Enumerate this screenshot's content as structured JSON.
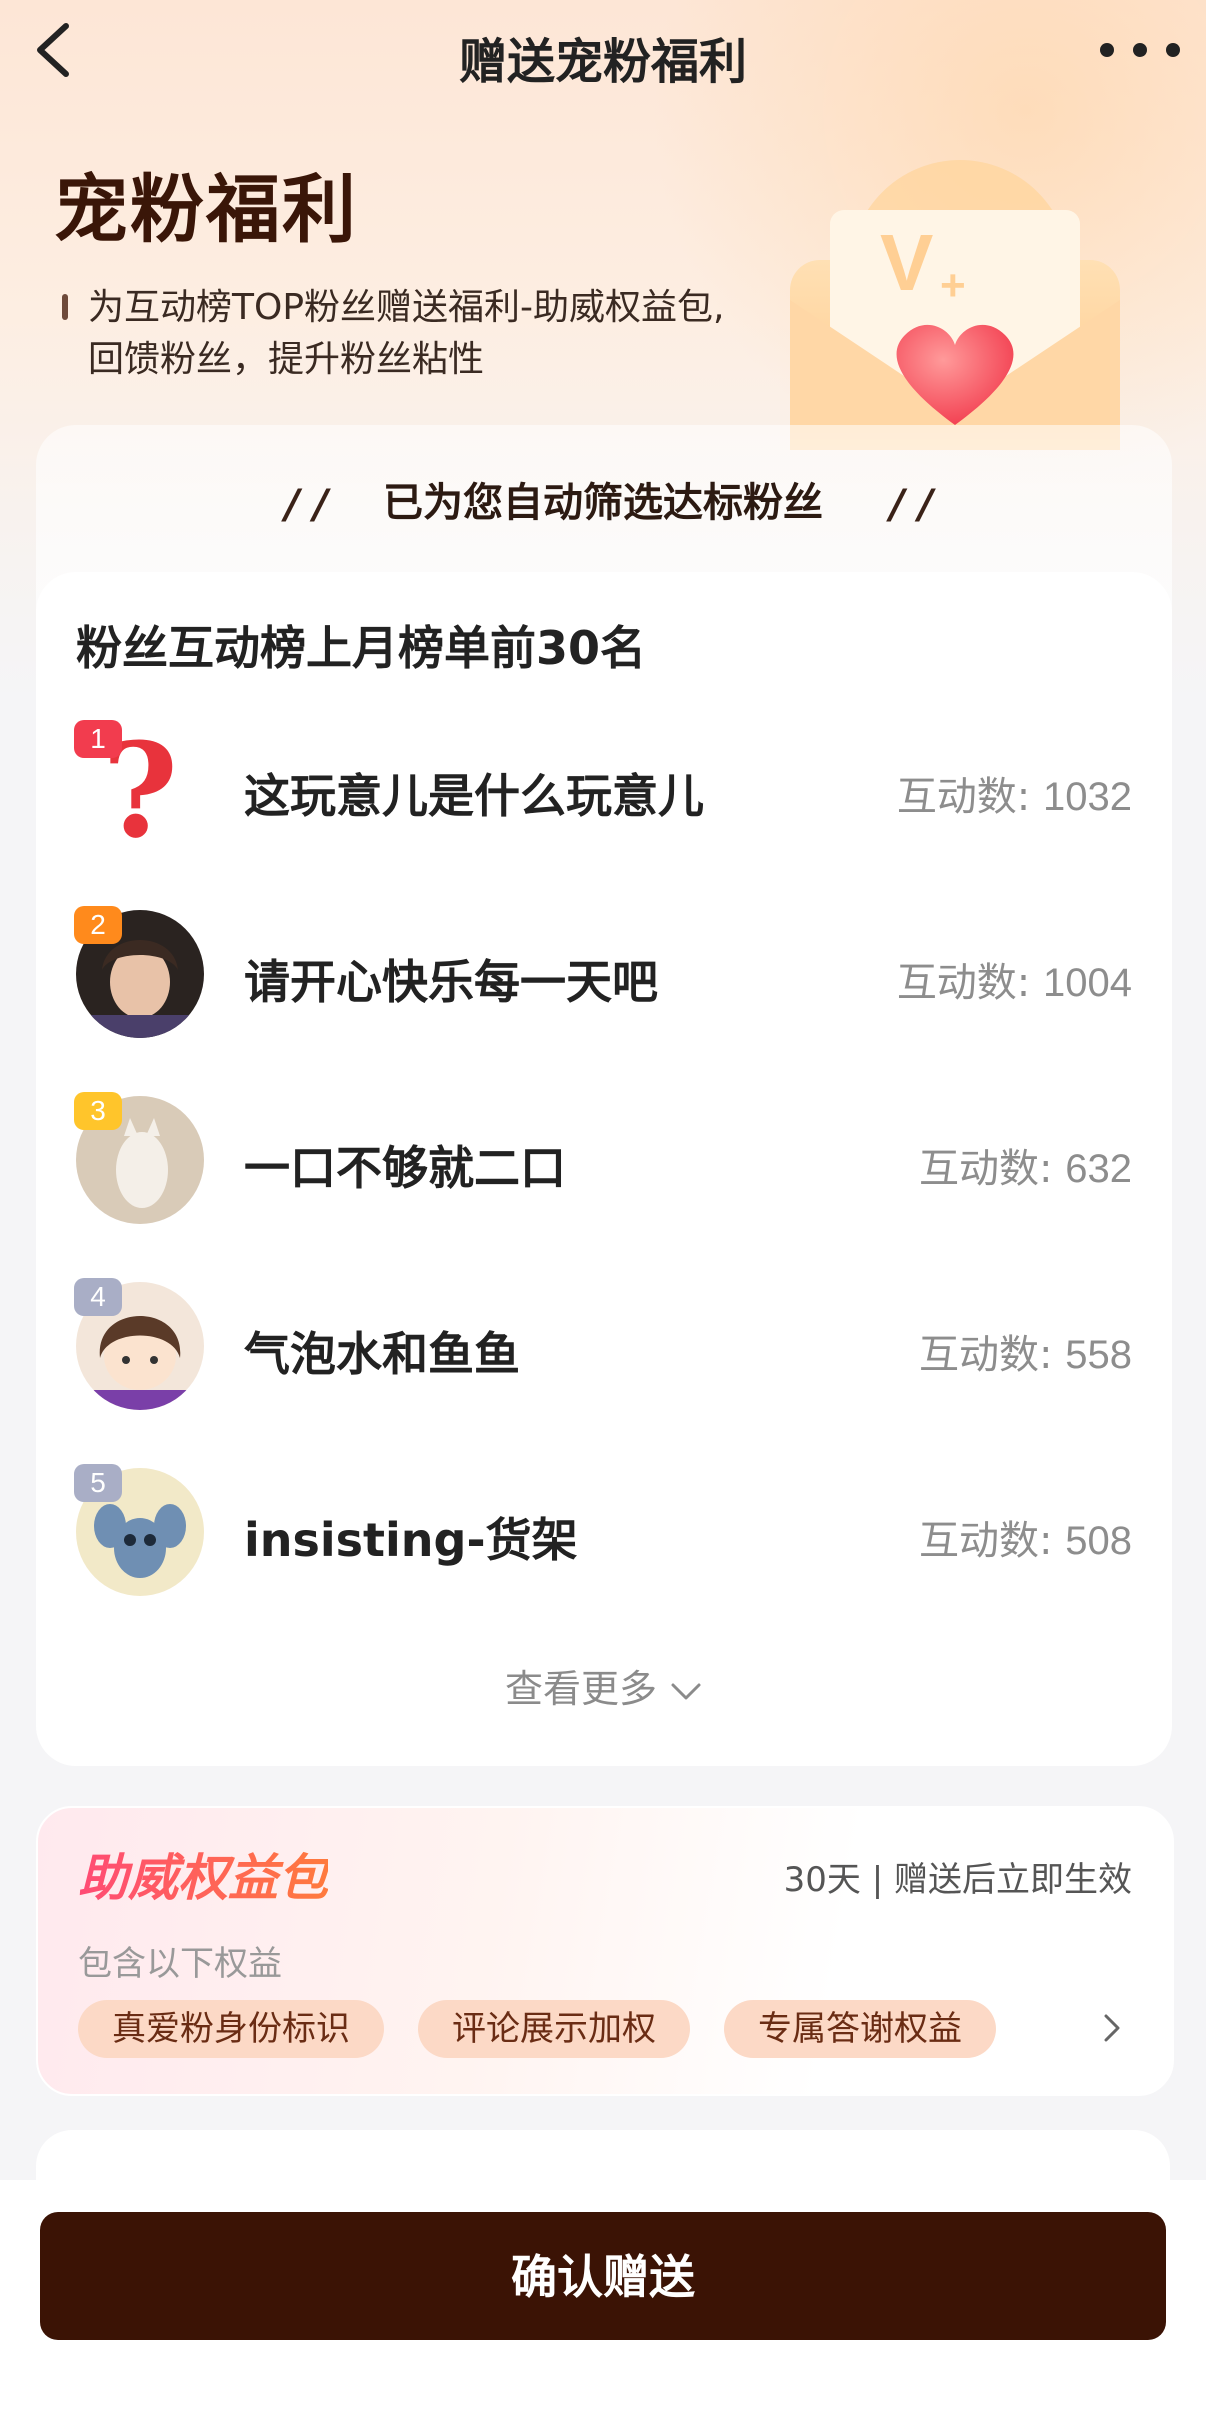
{
  "nav": {
    "title": "赠送宠粉福利"
  },
  "hero": {
    "title": "宠粉福利",
    "desc_line1": "为互动榜TOP粉丝赠送福利-助威权益包,",
    "desc_line2": "回馈粉丝，提升粉丝粘性"
  },
  "filter": {
    "text": "已为您自动筛选达标粉丝",
    "quote_open": "/ /",
    "quote_close": "/ /"
  },
  "ranking": {
    "title": "粉丝互动榜上月榜单前30名",
    "count_label": "互动数:",
    "items": [
      {
        "rank": "1",
        "name": "这玩意儿是什么玩意儿",
        "count": "1032"
      },
      {
        "rank": "2",
        "name": "请开心快乐每一天吧",
        "count": "1004"
      },
      {
        "rank": "3",
        "name": "一口不够就二口",
        "count": "632"
      },
      {
        "rank": "4",
        "name": "气泡水和鱼鱼",
        "count": "558"
      },
      {
        "rank": "5",
        "name": "insisting-货架",
        "count": "508"
      }
    ],
    "see_more": "查看更多"
  },
  "package": {
    "title": "助威权益包",
    "meta": "30天 | 赠送后立即生效",
    "subtitle": "包含以下权益",
    "chips": [
      "真爱粉身份标识",
      "评论展示加权",
      "专属答谢权益"
    ]
  },
  "footer": {
    "confirm_label": "确认赠送"
  },
  "colors": {
    "rank1": "#f23c4e",
    "rank2": "#ff8a1c",
    "rank3": "#ffc52b",
    "rank_other": "#a9aec6",
    "confirm_bg": "#3b1305",
    "accent": "#ff4b75"
  }
}
